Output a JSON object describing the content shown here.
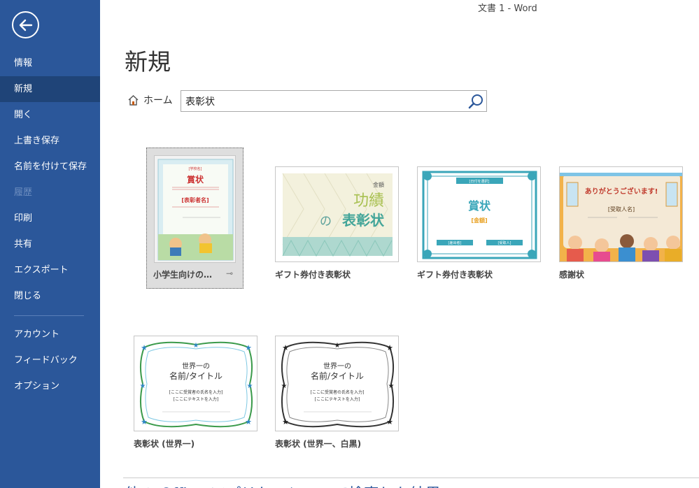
{
  "window": {
    "title": "文書 1 - Word"
  },
  "sidebar": {
    "back_icon": "back-arrow-icon",
    "items": [
      {
        "label": "情報",
        "state": "normal"
      },
      {
        "label": "新規",
        "state": "active"
      },
      {
        "label": "開く",
        "state": "normal"
      },
      {
        "label": "上書き保存",
        "state": "normal"
      },
      {
        "label": "名前を付けて保存",
        "state": "normal"
      },
      {
        "label": "履歴",
        "state": "disabled"
      },
      {
        "label": "印刷",
        "state": "normal"
      },
      {
        "label": "共有",
        "state": "normal"
      },
      {
        "label": "エクスポート",
        "state": "normal"
      },
      {
        "label": "閉じる",
        "state": "normal"
      }
    ],
    "bottom_items": [
      {
        "label": "アカウント"
      },
      {
        "label": "フィードバック"
      },
      {
        "label": "オプション"
      }
    ]
  },
  "main": {
    "title": "新規",
    "home_label": "ホーム",
    "search": {
      "value": "表彰状"
    },
    "templates": [
      {
        "label": "小学生向けの…",
        "selected": true,
        "thumb": {
          "top": "[学校名]",
          "title": "賞状",
          "name": "[表彰者名]"
        }
      },
      {
        "label": "ギフト券付き表彰状",
        "thumb": {
          "corner": "金額",
          "line1": "功績",
          "line2a": "の",
          "line2b": "表彰状"
        }
      },
      {
        "label": "ギフト券付き表彰状",
        "thumb": {
          "top": "[日付を選択]",
          "title": "賞状",
          "amount": "[金額]",
          "left": "[差出者]",
          "right": "[受取人]"
        }
      },
      {
        "label": "感謝状",
        "thumb": {
          "title": "ありがとうございます!",
          "name": "[受取人名]"
        }
      },
      {
        "label": "表彰状 (世界一)",
        "thumb": {
          "line1": "世界一の",
          "line2": "名前/タイトル",
          "line3": "[ここに受賞者の氏名を入力]",
          "line4": "[ここにテキストを入力]"
        }
      },
      {
        "label": "表彰状 (世界一、白黒)",
        "thumb": {
          "line1": "世界一の",
          "line2": "名前/タイトル",
          "line3": "[ここに受賞者の氏名を入力]",
          "line4": "[ここにテキストを入力]"
        }
      }
    ],
    "bottom_heading": "他の Office アプリケーションで検索した結果"
  },
  "colors": {
    "sidebar": "#2b579a",
    "sidebar_active": "#1f4478",
    "accent_blue": "#2b579a"
  }
}
